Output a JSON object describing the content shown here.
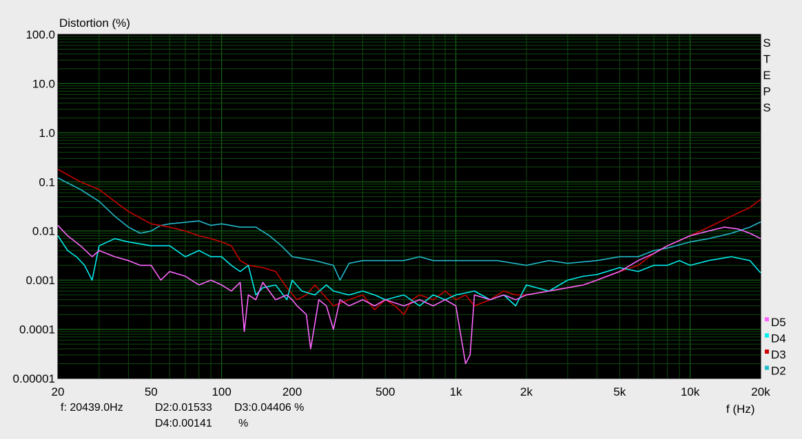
{
  "chart_data": {
    "type": "line",
    "ylabel": "Distortion (%)",
    "xlabel": "f (Hz)",
    "x_scale": "log",
    "y_scale": "log",
    "xlim": [
      20,
      20000
    ],
    "ylim": [
      1e-05,
      100
    ],
    "grid": true,
    "background": "#000000",
    "grid_color": "#1a7a1a",
    "x_ticks": [
      {
        "value": 20,
        "label": "20"
      },
      {
        "value": 50,
        "label": "50"
      },
      {
        "value": 100,
        "label": "100"
      },
      {
        "value": 200,
        "label": "200"
      },
      {
        "value": 500,
        "label": "500"
      },
      {
        "value": 1000,
        "label": "1k"
      },
      {
        "value": 2000,
        "label": "2k"
      },
      {
        "value": 5000,
        "label": "5k"
      },
      {
        "value": 10000,
        "label": "10k"
      },
      {
        "value": 20000,
        "label": "20k"
      }
    ],
    "y_ticks": [
      {
        "value": 100,
        "label": "100.0"
      },
      {
        "value": 10,
        "label": "10.0"
      },
      {
        "value": 1,
        "label": "1.0"
      },
      {
        "value": 0.1,
        "label": "0.1"
      },
      {
        "value": 0.01,
        "label": "0.01"
      },
      {
        "value": 0.001,
        "label": "0.001"
      },
      {
        "value": 0.0001,
        "label": "0.0001"
      },
      {
        "value": 1e-05,
        "label": "0.00001"
      }
    ],
    "side_label": [
      "S",
      "T",
      "E",
      "P",
      "S"
    ],
    "legend_position": "bottom-right",
    "series": [
      {
        "name": "D2",
        "color": "#22bbcc",
        "points": [
          [
            20,
            0.12
          ],
          [
            25,
            0.07
          ],
          [
            30,
            0.04
          ],
          [
            35,
            0.02
          ],
          [
            40,
            0.012
          ],
          [
            45,
            0.009
          ],
          [
            50,
            0.01
          ],
          [
            55,
            0.013
          ],
          [
            60,
            0.014
          ],
          [
            70,
            0.015
          ],
          [
            80,
            0.016
          ],
          [
            90,
            0.013
          ],
          [
            100,
            0.014
          ],
          [
            120,
            0.012
          ],
          [
            140,
            0.012
          ],
          [
            160,
            0.008
          ],
          [
            180,
            0.005
          ],
          [
            200,
            0.003
          ],
          [
            250,
            0.0025
          ],
          [
            300,
            0.002
          ],
          [
            320,
            0.001
          ],
          [
            350,
            0.0022
          ],
          [
            400,
            0.0025
          ],
          [
            500,
            0.0025
          ],
          [
            600,
            0.0025
          ],
          [
            700,
            0.003
          ],
          [
            800,
            0.0025
          ],
          [
            1000,
            0.0025
          ],
          [
            1200,
            0.0025
          ],
          [
            1500,
            0.0025
          ],
          [
            2000,
            0.002
          ],
          [
            2500,
            0.0025
          ],
          [
            3000,
            0.0022
          ],
          [
            4000,
            0.0025
          ],
          [
            5000,
            0.003
          ],
          [
            6000,
            0.003
          ],
          [
            7000,
            0.004
          ],
          [
            8000,
            0.0045
          ],
          [
            10000,
            0.006
          ],
          [
            12000,
            0.007
          ],
          [
            15000,
            0.009
          ],
          [
            18000,
            0.012
          ],
          [
            20000,
            0.0153
          ]
        ]
      },
      {
        "name": "D3",
        "color": "#cc0000",
        "points": [
          [
            20,
            0.18
          ],
          [
            25,
            0.1
          ],
          [
            30,
            0.07
          ],
          [
            35,
            0.04
          ],
          [
            40,
            0.025
          ],
          [
            50,
            0.014
          ],
          [
            60,
            0.012
          ],
          [
            70,
            0.01
          ],
          [
            80,
            0.008
          ],
          [
            90,
            0.007
          ],
          [
            100,
            0.006
          ],
          [
            110,
            0.005
          ],
          [
            120,
            0.0025
          ],
          [
            130,
            0.002
          ],
          [
            150,
            0.0018
          ],
          [
            170,
            0.0015
          ],
          [
            190,
            0.0007
          ],
          [
            210,
            0.0004
          ],
          [
            230,
            0.0005
          ],
          [
            250,
            0.0008
          ],
          [
            300,
            0.0003
          ],
          [
            350,
            0.0004
          ],
          [
            400,
            0.0005
          ],
          [
            450,
            0.00025
          ],
          [
            500,
            0.0004
          ],
          [
            550,
            0.0003
          ],
          [
            600,
            0.0002
          ],
          [
            650,
            0.0004
          ],
          [
            700,
            0.0005
          ],
          [
            800,
            0.0004
          ],
          [
            900,
            0.0006
          ],
          [
            1000,
            0.0004
          ],
          [
            1100,
            0.0005
          ],
          [
            1200,
            0.0003
          ],
          [
            1400,
            0.0004
          ],
          [
            1600,
            0.0006
          ],
          [
            1800,
            0.0005
          ],
          [
            2000,
            0.0005
          ],
          [
            2500,
            0.0006
          ],
          [
            3000,
            0.0007
          ],
          [
            3500,
            0.0008
          ],
          [
            4000,
            0.001
          ],
          [
            5000,
            0.0015
          ],
          [
            6000,
            0.002
          ],
          [
            7000,
            0.0035
          ],
          [
            8000,
            0.005
          ],
          [
            10000,
            0.008
          ],
          [
            12000,
            0.012
          ],
          [
            15000,
            0.02
          ],
          [
            18000,
            0.03
          ],
          [
            20000,
            0.0441
          ]
        ]
      },
      {
        "name": "D4",
        "color": "#00eeee",
        "points": [
          [
            20,
            0.008
          ],
          [
            22,
            0.004
          ],
          [
            24,
            0.003
          ],
          [
            26,
            0.002
          ],
          [
            28,
            0.001
          ],
          [
            30,
            0.005
          ],
          [
            35,
            0.007
          ],
          [
            40,
            0.006
          ],
          [
            50,
            0.005
          ],
          [
            60,
            0.005
          ],
          [
            70,
            0.003
          ],
          [
            80,
            0.004
          ],
          [
            90,
            0.003
          ],
          [
            100,
            0.003
          ],
          [
            110,
            0.002
          ],
          [
            120,
            0.0015
          ],
          [
            130,
            0.002
          ],
          [
            140,
            0.0005
          ],
          [
            150,
            0.0007
          ],
          [
            170,
            0.0008
          ],
          [
            190,
            0.0004
          ],
          [
            200,
            0.001
          ],
          [
            220,
            0.0006
          ],
          [
            250,
            0.0005
          ],
          [
            280,
            0.0008
          ],
          [
            300,
            0.0006
          ],
          [
            350,
            0.0005
          ],
          [
            400,
            0.0006
          ],
          [
            450,
            0.0005
          ],
          [
            500,
            0.0004
          ],
          [
            600,
            0.0005
          ],
          [
            700,
            0.0003
          ],
          [
            800,
            0.0005
          ],
          [
            900,
            0.0004
          ],
          [
            1000,
            0.0005
          ],
          [
            1200,
            0.0006
          ],
          [
            1400,
            0.0004
          ],
          [
            1600,
            0.0005
          ],
          [
            1800,
            0.0003
          ],
          [
            2000,
            0.0008
          ],
          [
            2500,
            0.0006
          ],
          [
            3000,
            0.001
          ],
          [
            3500,
            0.0012
          ],
          [
            4000,
            0.0013
          ],
          [
            5000,
            0.0018
          ],
          [
            6000,
            0.0015
          ],
          [
            7000,
            0.002
          ],
          [
            8000,
            0.002
          ],
          [
            9000,
            0.0025
          ],
          [
            10000,
            0.002
          ],
          [
            12000,
            0.0025
          ],
          [
            15000,
            0.003
          ],
          [
            18000,
            0.0025
          ],
          [
            20000,
            0.00141
          ]
        ]
      },
      {
        "name": "D5",
        "color": "#ff66ff",
        "points": [
          [
            20,
            0.013
          ],
          [
            22,
            0.008
          ],
          [
            25,
            0.005
          ],
          [
            28,
            0.003
          ],
          [
            30,
            0.004
          ],
          [
            35,
            0.003
          ],
          [
            40,
            0.0025
          ],
          [
            45,
            0.002
          ],
          [
            50,
            0.002
          ],
          [
            55,
            0.001
          ],
          [
            60,
            0.0015
          ],
          [
            70,
            0.0012
          ],
          [
            80,
            0.0008
          ],
          [
            90,
            0.001
          ],
          [
            100,
            0.0008
          ],
          [
            110,
            0.0006
          ],
          [
            120,
            0.0009
          ],
          [
            125,
            9e-05
          ],
          [
            130,
            0.0005
          ],
          [
            140,
            0.0004
          ],
          [
            150,
            0.0009
          ],
          [
            170,
            0.0004
          ],
          [
            190,
            0.0005
          ],
          [
            200,
            0.0004
          ],
          [
            210,
            0.0003
          ],
          [
            230,
            0.0002
          ],
          [
            240,
            4e-05
          ],
          [
            260,
            0.0004
          ],
          [
            280,
            0.0003
          ],
          [
            300,
            0.0001
          ],
          [
            320,
            0.0004
          ],
          [
            350,
            0.0003
          ],
          [
            400,
            0.0004
          ],
          [
            450,
            0.0003
          ],
          [
            500,
            0.0004
          ],
          [
            600,
            0.0003
          ],
          [
            700,
            0.0004
          ],
          [
            800,
            0.0003
          ],
          [
            900,
            0.0004
          ],
          [
            1000,
            0.0003
          ],
          [
            1100,
            2e-05
          ],
          [
            1150,
            3e-05
          ],
          [
            1200,
            0.0005
          ],
          [
            1400,
            0.0004
          ],
          [
            1600,
            0.0005
          ],
          [
            1800,
            0.0004
          ],
          [
            2000,
            0.0005
          ],
          [
            2500,
            0.0006
          ],
          [
            3000,
            0.0007
          ],
          [
            3500,
            0.0008
          ],
          [
            4000,
            0.001
          ],
          [
            5000,
            0.0015
          ],
          [
            6000,
            0.0025
          ],
          [
            7000,
            0.0035
          ],
          [
            8000,
            0.005
          ],
          [
            10000,
            0.008
          ],
          [
            12000,
            0.01
          ],
          [
            14000,
            0.012
          ],
          [
            16000,
            0.011
          ],
          [
            18000,
            0.009
          ],
          [
            20000,
            0.007
          ]
        ]
      }
    ],
    "legend": [
      {
        "name": "D5",
        "color": "#ff66ff"
      },
      {
        "name": "D4",
        "color": "#00eeee"
      },
      {
        "name": "D3",
        "color": "#cc0000"
      },
      {
        "name": "D2",
        "color": "#22bbcc"
      }
    ]
  },
  "readout": {
    "freq": "f: 20439.0Hz",
    "d2": "D2:0.01533",
    "d3": "D3:0.04406 %",
    "d4": "D4:0.00141",
    "d4_unit": "%"
  }
}
